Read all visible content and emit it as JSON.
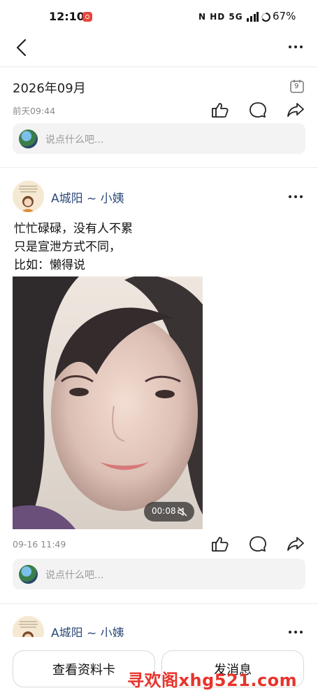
{
  "status_bar": {
    "time": "12:10",
    "icons_text": "N HD 5G",
    "battery": "67%"
  },
  "nav": {
    "back_icon": "chevron-left-icon",
    "more_icon": "more-dots-icon"
  },
  "post1": {
    "month_title": "2026年09月",
    "calendar_day": "9",
    "time": "前天09:44",
    "comment_placeholder": "说点什么吧..."
  },
  "post2": {
    "author": "A城阳 ~ 小姨",
    "text_lines": [
      "忙忙碌碌，没有人不累",
      "只是宣泄方式不同，",
      "比如：懒得说"
    ],
    "video_duration": "00:08",
    "time": "09-16 11:49",
    "comment_placeholder": "说点什么吧..."
  },
  "post3": {
    "author": "A城阳 ~ 小姨"
  },
  "bottom": {
    "view_profile": "查看资料卡",
    "send_message": "发消息"
  },
  "watermark": "寻欢阁xhg521.com",
  "colors": {
    "author_name": "#2f4b7a",
    "watermark": "#e8332b",
    "comment_box": "#f3f3f3"
  }
}
